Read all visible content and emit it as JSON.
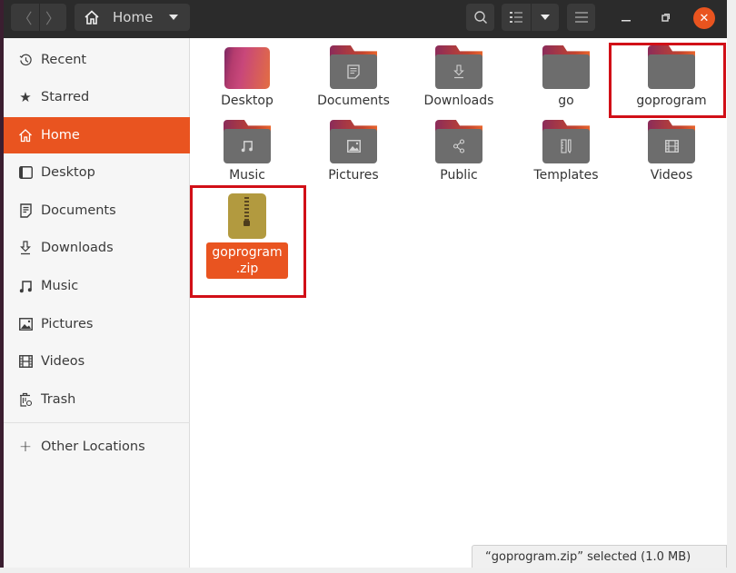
{
  "window": {
    "location_label": "Home",
    "nav": {
      "back": "back",
      "forward": "forward"
    },
    "toolbar_icons": [
      "search-icon",
      "list-view-icon",
      "view-options-dropdown",
      "hamburger-menu-icon"
    ],
    "window_controls": [
      "minimize",
      "maximize",
      "close"
    ]
  },
  "sidebar": {
    "items": [
      {
        "label": "Recent",
        "icon": "clock-icon",
        "active": false
      },
      {
        "label": "Starred",
        "icon": "star-icon",
        "active": false
      },
      {
        "label": "Home",
        "icon": "home-icon",
        "active": true
      },
      {
        "label": "Desktop",
        "icon": "desktop-icon",
        "active": false
      },
      {
        "label": "Documents",
        "icon": "document-icon",
        "active": false
      },
      {
        "label": "Downloads",
        "icon": "download-icon",
        "active": false
      },
      {
        "label": "Music",
        "icon": "music-icon",
        "active": false
      },
      {
        "label": "Pictures",
        "icon": "picture-icon",
        "active": false
      },
      {
        "label": "Videos",
        "icon": "film-icon",
        "active": false
      },
      {
        "label": "Trash",
        "icon": "trash-icon",
        "active": false
      }
    ],
    "other_locations": "Other Locations"
  },
  "files": [
    {
      "name": "Desktop",
      "type": "desktop-folder"
    },
    {
      "name": "Documents",
      "type": "folder",
      "emblem": "document"
    },
    {
      "name": "Downloads",
      "type": "folder",
      "emblem": "download"
    },
    {
      "name": "go",
      "type": "folder"
    },
    {
      "name": "goprogram",
      "type": "folder",
      "highlighted": true
    },
    {
      "name": "Music",
      "type": "folder",
      "emblem": "music"
    },
    {
      "name": "Pictures",
      "type": "folder",
      "emblem": "picture"
    },
    {
      "name": "Public",
      "type": "folder",
      "emblem": "share"
    },
    {
      "name": "Templates",
      "type": "folder",
      "emblem": "template"
    },
    {
      "name": "Videos",
      "type": "folder",
      "emblem": "film"
    },
    {
      "name": "goprogram.zip",
      "line1": "goprogram",
      "line2": ".zip",
      "type": "zip-archive",
      "selected": true,
      "highlighted": true
    }
  ],
  "status": {
    "text": "“goprogram.zip” selected  (1.0 MB)"
  },
  "colors": {
    "accent": "#e95420",
    "highlight_box": "#d10f17",
    "headerbar": "#2b2b2b"
  }
}
